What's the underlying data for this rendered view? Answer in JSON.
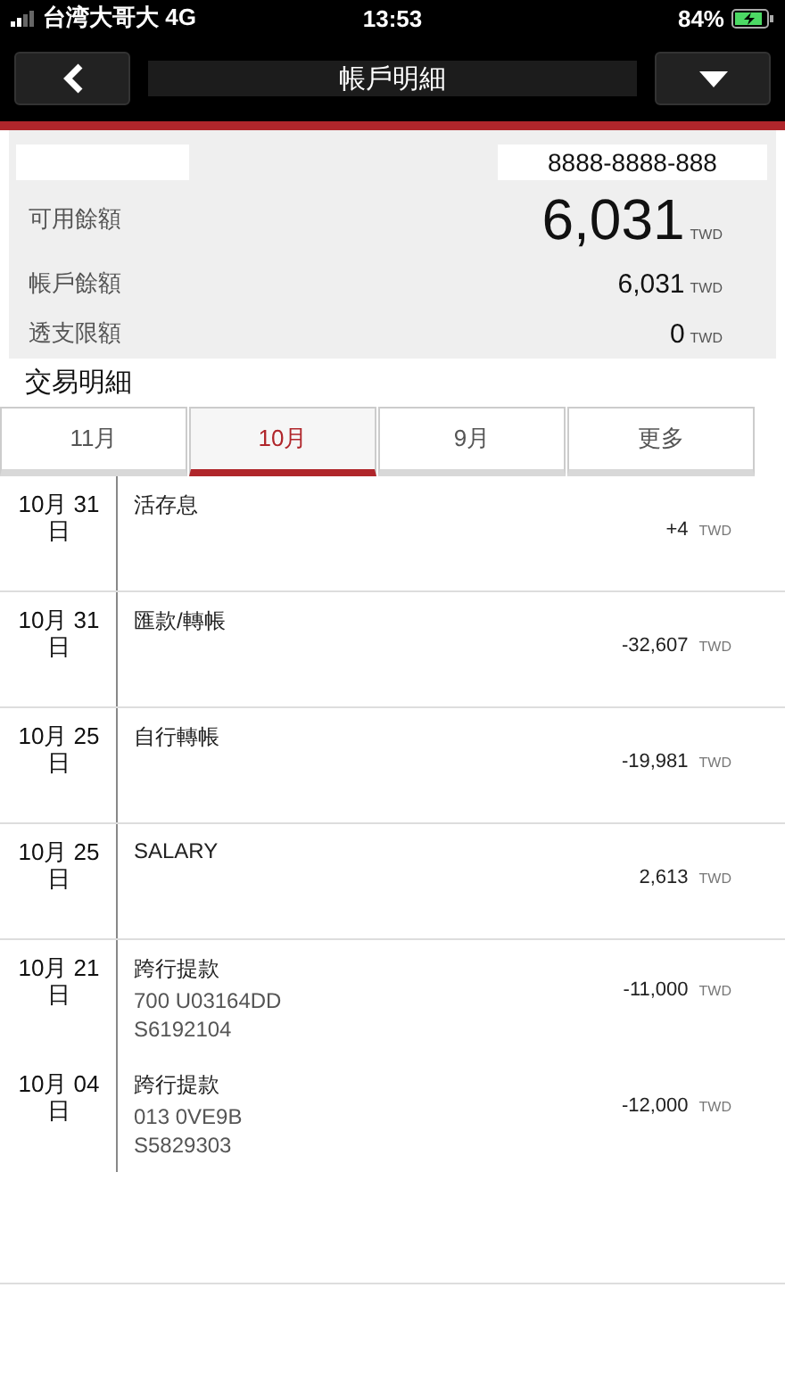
{
  "status_bar": {
    "carrier": "台湾大哥大 4G",
    "time": "13:53",
    "battery": "84%"
  },
  "nav": {
    "title": "帳戶明細"
  },
  "account": {
    "number": "8888-8888-888",
    "balances": [
      {
        "label": "可用餘額",
        "amount": "6,031",
        "currency": "TWD",
        "kind": "main"
      },
      {
        "label": "帳戶餘額",
        "amount": "6,031",
        "currency": "TWD",
        "kind": "normal"
      },
      {
        "label": "透支限額",
        "amount": "0",
        "currency": "TWD",
        "kind": "normal"
      }
    ]
  },
  "section_title": "交易明細",
  "tabs": [
    {
      "label": "11月",
      "selected": false
    },
    {
      "label": "10月",
      "selected": true
    },
    {
      "label": "9月",
      "selected": false
    },
    {
      "label": "更多",
      "selected": false
    }
  ],
  "transactions": [
    {
      "date": "10月 31 日",
      "description": "活存息",
      "amount": "+4",
      "currency": "TWD"
    },
    {
      "date": "10月 31 日",
      "description": "匯款/轉帳",
      "amount": "-32,607",
      "currency": "TWD"
    },
    {
      "date": "10月 25 日",
      "description": "自行轉帳",
      "amount": "-19,981",
      "currency": "TWD"
    },
    {
      "date": "10月 25 日",
      "description": "SALARY",
      "amount": "2,613",
      "currency": "TWD"
    },
    {
      "date": "10月 21 日",
      "description": "跨行提款",
      "details": [
        "700 U03164DD",
        "S6192104"
      ],
      "amount": "-11,000",
      "currency": "TWD"
    },
    {
      "date": "10月 04 日",
      "description": "跨行提款",
      "details": [
        "013 0VE9B",
        "S5829303"
      ],
      "amount": "-12,000",
      "currency": "TWD"
    }
  ]
}
